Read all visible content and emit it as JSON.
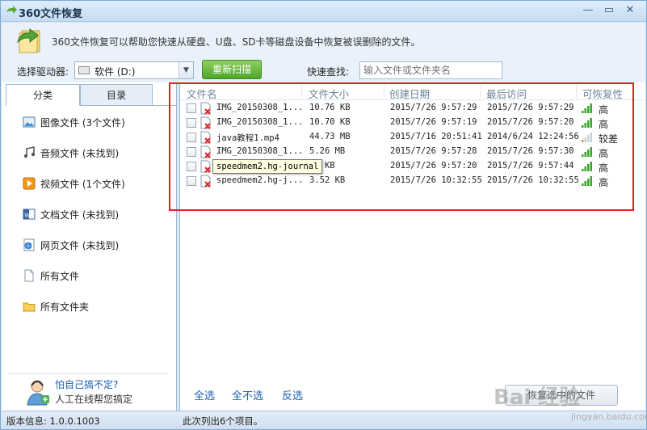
{
  "window": {
    "title": "360文件恢复"
  },
  "banner": {
    "text": "360文件恢复可以帮助您快速从硬盘、U盘、SD卡等磁盘设备中恢复被误删除的文件。"
  },
  "toolbar": {
    "drive_label": "选择驱动器:",
    "drive_value": "软件  (D:)",
    "rescan_label": "重新扫描",
    "quick_label": "快速查找:",
    "quick_placeholder": "输入文件或文件夹名"
  },
  "tabs": [
    {
      "label": "分类"
    },
    {
      "label": "目录"
    }
  ],
  "categories": [
    {
      "label": "图像文件 (3个文件)",
      "icon": "image-icon"
    },
    {
      "label": "音频文件 (未找到)",
      "icon": "music-icon"
    },
    {
      "label": "视频文件 (1个文件)",
      "icon": "video-icon"
    },
    {
      "label": "文档文件 (未找到)",
      "icon": "document-icon"
    },
    {
      "label": "网页文件 (未找到)",
      "icon": "webpage-icon"
    },
    {
      "label": "所有文件",
      "icon": "file-icon"
    },
    {
      "label": "所有文件夹",
      "icon": "folder-icon"
    }
  ],
  "help": {
    "link": "怕自己搞不定?",
    "sub": "人工在线帮您搞定"
  },
  "table": {
    "headers": [
      "文件名",
      "文件大小",
      "创建日期",
      "最后访问",
      "可恢复性"
    ],
    "rows": [
      {
        "name": "IMG_20150308_1...",
        "size": "10.76 KB",
        "created": "2015/7/26 9:57:29",
        "accessed": "2015/7/26 9:57:29",
        "recover": "高",
        "level": 4
      },
      {
        "name": "IMG_20150308_1...",
        "size": "10.70 KB",
        "created": "2015/7/26 9:57:19",
        "accessed": "2015/7/26 9:57:20",
        "recover": "高",
        "level": 4
      },
      {
        "name": "java教程1.mp4",
        "size": "44.73 MB",
        "created": "2015/7/16 20:51:41",
        "accessed": "2014/6/24 12:24:56",
        "recover": "较差",
        "level": 1
      },
      {
        "name": "IMG_20150308_1...",
        "size": "5.26 MB",
        "created": "2015/7/26 9:57:28",
        "accessed": "2015/7/26 9:57:30",
        "recover": "高",
        "level": 4
      },
      {
        "name": "speedmem2.hg-journal",
        "size": "52 KB",
        "created": "2015/7/26 9:57:20",
        "accessed": "2015/7/26 9:57:44",
        "recover": "高",
        "level": 4
      },
      {
        "name": "speedmem2.hg-j...",
        "size": "3.52 KB",
        "created": "2015/7/26 10:32:55",
        "accessed": "2015/7/26 10:32:55",
        "recover": "高",
        "level": 4
      }
    ]
  },
  "tooltip": "speedmem2.hg-journal",
  "actions": {
    "select_all": "全选",
    "select_none": "全不选",
    "invert": "反选",
    "restore": "恢复选中的文件"
  },
  "status": {
    "version": "版本信息: 1.0.0.1003",
    "count": "此次列出6个项目。"
  },
  "watermark": {
    "main": "Bai 经验",
    "sub": "jingyan.baidu.com"
  },
  "colors": {
    "signal_good": "#3aa52a",
    "signal_poor": "#e0a020",
    "signal_off": "#c9d3dc",
    "highlight": "#e02020",
    "accent": "#4ea62a"
  }
}
